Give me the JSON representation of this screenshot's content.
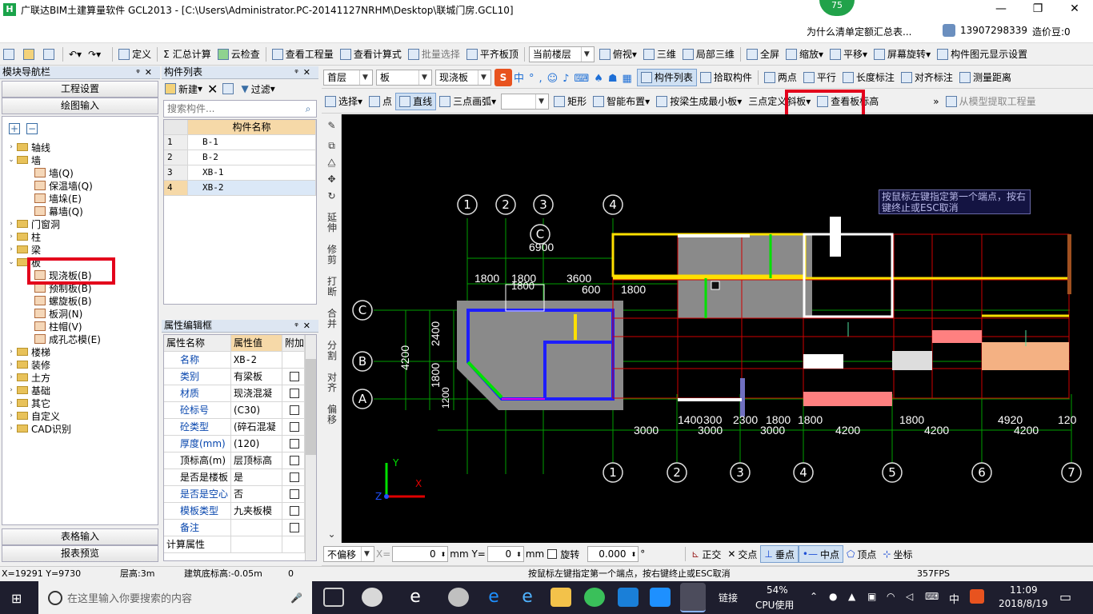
{
  "window": {
    "title": "广联达BIM土建算量软件 GCL2013 - [C:\\Users\\Administrator.PC-20141127NRHM\\Desktop\\联城门房.GCL10]",
    "badge": "75",
    "minimize": "—",
    "restore": "❐",
    "close": "✕"
  },
  "notice": {
    "text": "为什么清单定额汇总表...",
    "user": "13907298339",
    "price": "造价豆:0"
  },
  "toolbar1": {
    "define": "定义",
    "sum_calc": "汇总计算",
    "cloud_check": "云检查",
    "view_qty": "查看工程量",
    "view_formula": "查看计算式",
    "batch_select": "批量选择",
    "align_top": "平齐板顶",
    "current_floor": "当前楼层",
    "plan_view": "俯视",
    "three_d": "三维",
    "local_3d": "局部三维",
    "fullscreen": "全屏",
    "zoom": "缩放",
    "pan": "平移",
    "rotate": "屏幕旋转",
    "component_display": "构件图元显示设置"
  },
  "toolbar2": {
    "floor": "首层",
    "type": "板",
    "subtype": "现浇板",
    "component_list": "构件列表",
    "pick": "拾取构件",
    "two_point": "两点",
    "parallel": "平行",
    "length_mark": "长度标注",
    "align_mark": "对齐标注",
    "measure": "测量距离"
  },
  "toolbar3": {
    "select": "选择",
    "point": "点",
    "line": "直线",
    "arc": "三点画弧",
    "rect": "矩形",
    "smart": "智能布置",
    "by_beam": "按梁生成最小板",
    "three_point_slope": "三点定义斜板",
    "view_elev": "查看板标高",
    "extract": "从模型提取工程量"
  },
  "nav": {
    "header": "模块导航栏",
    "project_settings": "工程设置",
    "drawing_input": "绘图输入",
    "table_input": "表格输入",
    "report_preview": "报表预览",
    "tree": [
      {
        "label": "轴线",
        "level": 0,
        "exp": "›"
      },
      {
        "label": "墙",
        "level": 0,
        "exp": "⌄"
      },
      {
        "label": "墙(Q)",
        "level": 1
      },
      {
        "label": "保温墙(Q)",
        "level": 1
      },
      {
        "label": "墙垛(E)",
        "level": 1
      },
      {
        "label": "幕墙(Q)",
        "level": 1
      },
      {
        "label": "门窗洞",
        "level": 0,
        "exp": "›"
      },
      {
        "label": "柱",
        "level": 0,
        "exp": "›"
      },
      {
        "label": "梁",
        "level": 0,
        "exp": "›"
      },
      {
        "label": "板",
        "level": 0,
        "exp": "⌄"
      },
      {
        "label": "现浇板(B)",
        "level": 1
      },
      {
        "label": "预制板(B)",
        "level": 1
      },
      {
        "label": "螺旋板(B)",
        "level": 1
      },
      {
        "label": "板洞(N)",
        "level": 1
      },
      {
        "label": "柱帽(V)",
        "level": 1
      },
      {
        "label": "成孔芯模(E)",
        "level": 1
      },
      {
        "label": "楼梯",
        "level": 0,
        "exp": "›"
      },
      {
        "label": "装修",
        "level": 0,
        "exp": "›"
      },
      {
        "label": "土方",
        "level": 0,
        "exp": "›"
      },
      {
        "label": "基础",
        "level": 0,
        "exp": "›"
      },
      {
        "label": "其它",
        "level": 0,
        "exp": "›"
      },
      {
        "label": "自定义",
        "level": 0,
        "exp": "›"
      },
      {
        "label": "CAD识别",
        "level": 0,
        "exp": "›"
      }
    ]
  },
  "component_list": {
    "header": "构件列表",
    "new": "新建",
    "filter": "过滤",
    "search_placeholder": "搜索构件...",
    "col_name": "构件名称",
    "rows": [
      {
        "idx": "1",
        "name": "B-1"
      },
      {
        "idx": "2",
        "name": "B-2"
      },
      {
        "idx": "3",
        "name": "XB-1"
      },
      {
        "idx": "4",
        "name": "XB-2"
      }
    ]
  },
  "props": {
    "header": "属性编辑框",
    "col_name": "属性名称",
    "col_value": "属性值",
    "col_extra": "附加",
    "rows": [
      {
        "name": "名称",
        "value": "XB-2",
        "blue": true,
        "check": false
      },
      {
        "name": "类别",
        "value": "有梁板",
        "blue": true,
        "check": true
      },
      {
        "name": "材质",
        "value": "现浇混凝",
        "blue": true,
        "check": true
      },
      {
        "name": "砼标号",
        "value": "(C30)",
        "blue": true,
        "check": true
      },
      {
        "name": "砼类型",
        "value": "(碎石混凝",
        "blue": true,
        "check": true
      },
      {
        "name": "厚度(mm)",
        "value": "(120)",
        "blue": true,
        "check": true
      },
      {
        "name": "顶标高(m)",
        "value": "层顶标高",
        "blue": false,
        "check": true
      },
      {
        "name": "是否是楼板",
        "value": "是",
        "blue": false,
        "check": true
      },
      {
        "name": "是否是空心",
        "value": "否",
        "blue": true,
        "check": true
      },
      {
        "name": "模板类型",
        "value": "九夹板模",
        "blue": true,
        "check": true
      },
      {
        "name": "备注",
        "value": "",
        "blue": true,
        "check": true
      },
      {
        "name": "计算属性",
        "value": "",
        "blue": false,
        "check": false
      }
    ]
  },
  "vertical_tools": [
    "延伸",
    "修剪",
    "打断",
    "合并",
    "分割",
    "对齐",
    "偏移"
  ],
  "canvas": {
    "prompt": "按鼠标左键指定第一个端点，按右键终止或ESC取消",
    "top_axes": [
      "1",
      "2",
      "3",
      "4"
    ],
    "bottom_axes": [
      "1",
      "2",
      "3",
      "4",
      "5",
      "6",
      "7"
    ],
    "left_axes": [
      "C",
      "B",
      "A"
    ],
    "top_axis_c": "C",
    "dims_top": [
      "6900",
      "1800",
      "1800",
      "1800",
      "3600",
      "600",
      "1800"
    ],
    "dims_left": [
      "4200",
      "2400",
      "1800",
      "1200"
    ],
    "dims_bottom_upper": [
      "1400",
      "300",
      "2300",
      "1800",
      "1800",
      "1800",
      "4920",
      "120"
    ],
    "dims_bottom": [
      "3000",
      "3000",
      "3000",
      "4200",
      "4200",
      "4200"
    ],
    "ucs": {
      "x": "X",
      "y": "Y",
      "z": "Z"
    }
  },
  "bottom_toolbar": {
    "offset": "不偏移",
    "x_label": "X=",
    "x_val": "0",
    "y_label": "mm Y=",
    "y_val": "0",
    "mm": "mm",
    "rotate": "旋转",
    "rot_val": "0.000",
    "deg": "°",
    "ortho": "正交",
    "intersect": "交点",
    "perp": "垂点",
    "mid": "中点",
    "vertex": "顶点",
    "coord": "坐标"
  },
  "status": {
    "coords": "X=19291 Y=9730",
    "floor_height": "层高:3m",
    "base_elev": "建筑底标高:-0.05m",
    "zero": "0",
    "prompt": "按鼠标左键指定第一个端点，按右键终止或ESC取消",
    "fps": "357FPS"
  },
  "taskbar": {
    "search": "在这里输入你要搜索的内容",
    "link": "链接",
    "cpu_pct": "54%",
    "cpu_label": "CPU使用",
    "ime": "中",
    "time": "11:09",
    "date": "2018/8/19"
  }
}
